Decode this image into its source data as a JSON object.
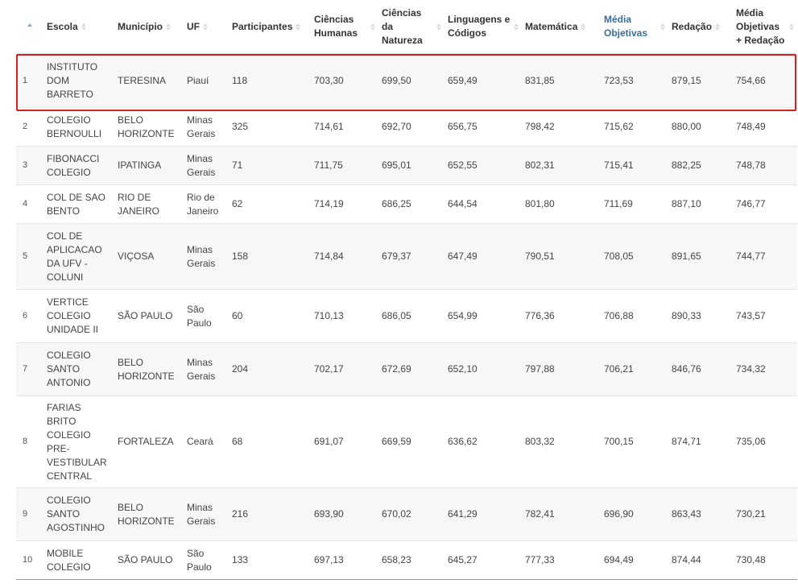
{
  "table": {
    "columns": [
      {
        "key": "idx",
        "label": "",
        "sort": "asc"
      },
      {
        "key": "escola",
        "label": "Escola",
        "sort": "both"
      },
      {
        "key": "municipio",
        "label": "Município",
        "sort": "both"
      },
      {
        "key": "uf",
        "label": "UF",
        "sort": "both"
      },
      {
        "key": "participantes",
        "label": "Participantes",
        "sort": "both"
      },
      {
        "key": "ch",
        "label": "Ciências Humanas",
        "sort": "both"
      },
      {
        "key": "cn",
        "label": "Ciências da Natureza",
        "sort": "both"
      },
      {
        "key": "lc",
        "label": "Linguagens e Códigos",
        "sort": "both"
      },
      {
        "key": "mat",
        "label": "Matemática",
        "sort": "both"
      },
      {
        "key": "mo",
        "label": "Média Objetivas",
        "sort": "both",
        "highlight": true
      },
      {
        "key": "red",
        "label": "Redação",
        "sort": "both"
      },
      {
        "key": "mor",
        "label": "Média Objetivas + Redação",
        "sort": "both"
      }
    ],
    "rows": [
      {
        "idx": "1",
        "escola": "INSTITUTO DOM BARRETO",
        "municipio": "TERESINA",
        "uf": "Piauí",
        "participantes": "118",
        "ch": "703,30",
        "cn": "699,50",
        "lc": "659,49",
        "mat": "831,85",
        "mo": "723,53",
        "red": "879,15",
        "mor": "754,66"
      },
      {
        "idx": "2",
        "escola": "COLEGIO BERNOULLI",
        "municipio": "BELO HORIZONTE",
        "uf": "Minas Gerais",
        "participantes": "325",
        "ch": "714,61",
        "cn": "692,70",
        "lc": "656,75",
        "mat": "798,42",
        "mo": "715,62",
        "red": "880,00",
        "mor": "748,49"
      },
      {
        "idx": "3",
        "escola": "FIBONACCI COLEGIO",
        "municipio": "IPATINGA",
        "uf": "Minas Gerais",
        "participantes": "71",
        "ch": "711,75",
        "cn": "695,01",
        "lc": "652,55",
        "mat": "802,31",
        "mo": "715,41",
        "red": "882,25",
        "mor": "748,78"
      },
      {
        "idx": "4",
        "escola": "COL DE SAO BENTO",
        "municipio": "RIO DE JANEIRO",
        "uf": "Rio de Janeiro",
        "participantes": "62",
        "ch": "714,19",
        "cn": "686,25",
        "lc": "644,54",
        "mat": "801,80",
        "mo": "711,69",
        "red": "887,10",
        "mor": "746,77"
      },
      {
        "idx": "5",
        "escola": "COL DE APLICACAO DA UFV - COLUNI",
        "municipio": "VIÇOSA",
        "uf": "Minas Gerais",
        "participantes": "158",
        "ch": "714,84",
        "cn": "679,37",
        "lc": "647,49",
        "mat": "790,51",
        "mo": "708,05",
        "red": "891,65",
        "mor": "744,77"
      },
      {
        "idx": "6",
        "escola": "VERTICE COLEGIO UNIDADE II",
        "municipio": "SÃO PAULO",
        "uf": "São Paulo",
        "participantes": "60",
        "ch": "710,13",
        "cn": "686,05",
        "lc": "654,99",
        "mat": "776,36",
        "mo": "706,88",
        "red": "890,33",
        "mor": "743,57"
      },
      {
        "idx": "7",
        "escola": "COLEGIO SANTO ANTONIO",
        "municipio": "BELO HORIZONTE",
        "uf": "Minas Gerais",
        "participantes": "204",
        "ch": "702,17",
        "cn": "672,69",
        "lc": "652,10",
        "mat": "797,88",
        "mo": "706,21",
        "red": "846,76",
        "mor": "734,32"
      },
      {
        "idx": "8",
        "escola": "FARIAS BRITO COLEGIO PRE-VESTIBULAR CENTRAL",
        "municipio": "FORTALEZA",
        "uf": "Ceará",
        "participantes": "68",
        "ch": "691,07",
        "cn": "669,59",
        "lc": "636,62",
        "mat": "803,32",
        "mo": "700,15",
        "red": "874,71",
        "mor": "735,06"
      },
      {
        "idx": "9",
        "escola": "COLEGIO SANTO AGOSTINHO",
        "municipio": "BELO HORIZONTE",
        "uf": "Minas Gerais",
        "participantes": "216",
        "ch": "693,90",
        "cn": "670,02",
        "lc": "641,29",
        "mat": "782,41",
        "mo": "696,90",
        "red": "863,43",
        "mor": "730,21"
      },
      {
        "idx": "10",
        "escola": "MOBILE COLEGIO",
        "municipio": "SÃO PAULO",
        "uf": "São Paulo",
        "participantes": "133",
        "ch": "697,13",
        "cn": "658,23",
        "lc": "645,27",
        "mat": "777,33",
        "mo": "694,49",
        "red": "874,44",
        "mor": "730,48"
      }
    ]
  },
  "colors": {
    "highlight_box": "#d42020",
    "highlight_header": "#3a6e98",
    "stripe": "#f7f7f7"
  }
}
